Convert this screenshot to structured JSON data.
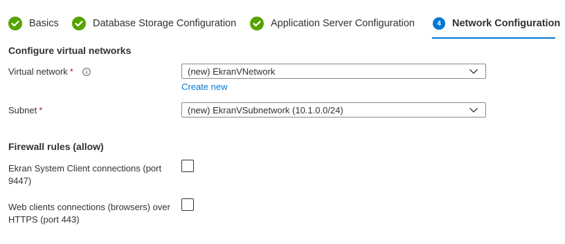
{
  "steps": [
    {
      "label": "Basics",
      "status": "complete"
    },
    {
      "label": "Database Storage Configuration",
      "status": "complete"
    },
    {
      "label": "Application Server Configuration",
      "status": "complete"
    },
    {
      "label": "Network Configuration",
      "status": "active",
      "number": "4"
    }
  ],
  "colors": {
    "complete": "#57a300",
    "accent": "#0078d4",
    "required": "#a4262c"
  },
  "network": {
    "title": "Configure virtual networks",
    "vnet_label": "Virtual network",
    "vnet_value": "(new) EkranVNetwork",
    "create_new": "Create new",
    "subnet_label": "Subnet",
    "subnet_value": "(new) EkranVSubnetwork (10.1.0.0/24)",
    "required_mark": "*"
  },
  "firewall": {
    "title": "Firewall rules (allow)",
    "rules": [
      {
        "label_line1": "Ekran System Client connections (port",
        "label_line2": "9447)",
        "checked": false
      },
      {
        "label_line1": "Web clients connections (browsers) over",
        "label_line2": "HTTPS (port 443)",
        "checked": false
      }
    ]
  }
}
